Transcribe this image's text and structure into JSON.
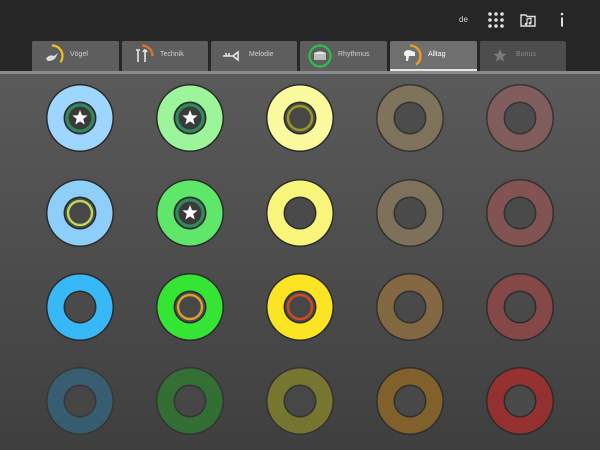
{
  "header": {
    "language": "de",
    "icons": [
      "grid-icon",
      "music-folder-icon",
      "info-icon"
    ]
  },
  "tabs": [
    {
      "label": "Vögel",
      "icon": "bird-icon",
      "arc_color": "#f2c21a",
      "progress": 0.35,
      "state": "normal"
    },
    {
      "label": "Technik",
      "icon": "tools-icon",
      "arc_color": "#e0742a",
      "progress": 0.25,
      "state": "normal"
    },
    {
      "label": "Melodie",
      "icon": "trumpet-icon",
      "arc_color": "",
      "progress": 0,
      "state": "normal"
    },
    {
      "label": "Rhythmus",
      "icon": "drum-icon",
      "arc_color": "#2fbf4a",
      "progress": 1.0,
      "state": "normal"
    },
    {
      "label": "Alltag",
      "icon": "hairdryer-icon",
      "arc_color": "#f0a020",
      "progress": 0.4,
      "state": "active"
    },
    {
      "label": "Bonus",
      "icon": "star-icon",
      "arc_color": "",
      "progress": 0,
      "state": "locked"
    }
  ],
  "board": {
    "columns": [
      {
        "rings": [
          {
            "fill": "#9fd6ff",
            "inner": "star",
            "inner_ring": "#2f8c5a",
            "opacity": 1
          },
          {
            "fill": "#8ecffa",
            "inner": "ring",
            "inner_ring": "#b6d85a",
            "opacity": 1
          },
          {
            "fill": "#38b8f6",
            "inner": "none",
            "inner_ring": "",
            "opacity": 1
          },
          {
            "fill": "#2f78a0",
            "inner": "none",
            "inner_ring": "",
            "opacity": 0.5
          }
        ]
      },
      {
        "rings": [
          {
            "fill": "#9cf59a",
            "inner": "star",
            "inner_ring": "#2f8c5a",
            "opacity": 1
          },
          {
            "fill": "#5fe76a",
            "inner": "star",
            "inner_ring": "#2f8c5a",
            "opacity": 1
          },
          {
            "fill": "#35e534",
            "inner": "ring",
            "inner_ring": "#d8a030",
            "opacity": 1
          },
          {
            "fill": "#2a8c2c",
            "inner": "none",
            "inner_ring": "",
            "opacity": 0.6
          }
        ]
      },
      {
        "rings": [
          {
            "fill": "#fbfa9e",
            "inner": "ring",
            "inner_ring": "#9a9a20",
            "opacity": 1
          },
          {
            "fill": "#f8f57a",
            "inner": "none",
            "inner_ring": "",
            "opacity": 1
          },
          {
            "fill": "#fbe423",
            "inner": "ring",
            "inner_ring": "#d04a20",
            "opacity": 1
          },
          {
            "fill": "#8c8c2a",
            "inner": "none",
            "inner_ring": "",
            "opacity": 0.7
          }
        ]
      },
      {
        "rings": [
          {
            "fill": "#8a7a5e",
            "inner": "none",
            "inner_ring": "",
            "opacity": 0.8
          },
          {
            "fill": "#8a7a5e",
            "inner": "none",
            "inner_ring": "",
            "opacity": 0.8
          },
          {
            "fill": "#8d6e42",
            "inner": "none",
            "inner_ring": "",
            "opacity": 0.85
          },
          {
            "fill": "#8c6628",
            "inner": "none",
            "inner_ring": "",
            "opacity": 0.85
          }
        ]
      },
      {
        "rings": [
          {
            "fill": "#8c5e5e",
            "inner": "none",
            "inner_ring": "",
            "opacity": 0.8
          },
          {
            "fill": "#8c5454",
            "inner": "none",
            "inner_ring": "",
            "opacity": 0.85
          },
          {
            "fill": "#8c4848",
            "inner": "none",
            "inner_ring": "",
            "opacity": 0.9
          },
          {
            "fill": "#9a3030",
            "inner": "none",
            "inner_ring": "",
            "opacity": 0.95
          }
        ]
      }
    ]
  }
}
